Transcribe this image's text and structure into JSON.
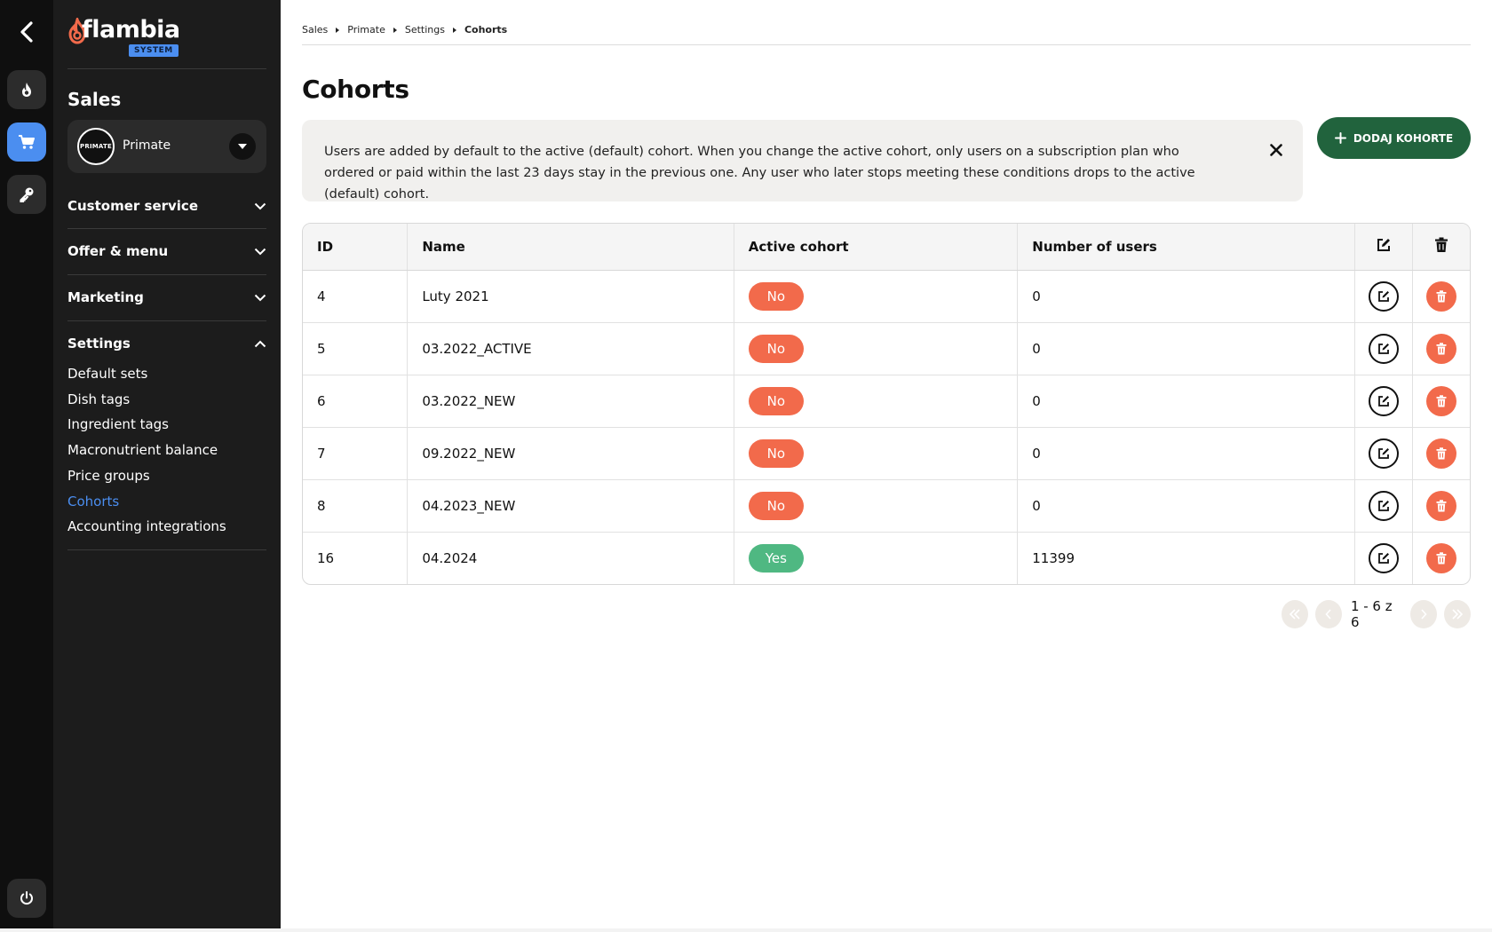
{
  "sidebar": {
    "logo_text": "flambia",
    "logo_badge": "SYSTEM",
    "section_title": "Sales",
    "brand": {
      "logo_text": "PRIMATE",
      "name": "Primate"
    },
    "nav": {
      "customer_service": "Customer service",
      "offer_menu": "Offer & menu",
      "marketing": "Marketing",
      "settings": "Settings"
    },
    "settings_items": [
      "Default sets",
      "Dish tags",
      "Ingredient tags",
      "Macronutrient balance",
      "Price groups",
      "Cohorts",
      "Accounting integrations"
    ]
  },
  "breadcrumb": [
    "Sales",
    "Primate",
    "Settings",
    "Cohorts"
  ],
  "page_title": "Cohorts",
  "info_text": "Users are added by default to the active (default) cohort. When you change the active cohort, only users on a subscription plan who ordered or paid within the last 23 days stay in the previous one. Any user who later stops meeting these conditions drops to the active (default) cohort.",
  "add_button_label": "DODAJ KOHORTE",
  "table": {
    "headers": {
      "id": "ID",
      "name": "Name",
      "active": "Active cohort",
      "users": "Number of users"
    },
    "rows": [
      {
        "id": "4",
        "name": "Luty 2021",
        "active": "No",
        "users": "0"
      },
      {
        "id": "5",
        "name": "03.2022_ACTIVE",
        "active": "No",
        "users": "0"
      },
      {
        "id": "6",
        "name": "03.2022_NEW",
        "active": "No",
        "users": "0"
      },
      {
        "id": "7",
        "name": "09.2022_NEW",
        "active": "No",
        "users": "0"
      },
      {
        "id": "8",
        "name": "04.2023_NEW",
        "active": "No",
        "users": "0"
      },
      {
        "id": "16",
        "name": "04.2024",
        "active": "Yes",
        "users": "11399"
      }
    ]
  },
  "pagination": {
    "label": "1 - 6 z 6"
  },
  "colors": {
    "accent_blue": "#4b8ef0",
    "primary_green": "#21633d",
    "no_pill": "#f26a4b",
    "yes_pill": "#4fb882"
  }
}
